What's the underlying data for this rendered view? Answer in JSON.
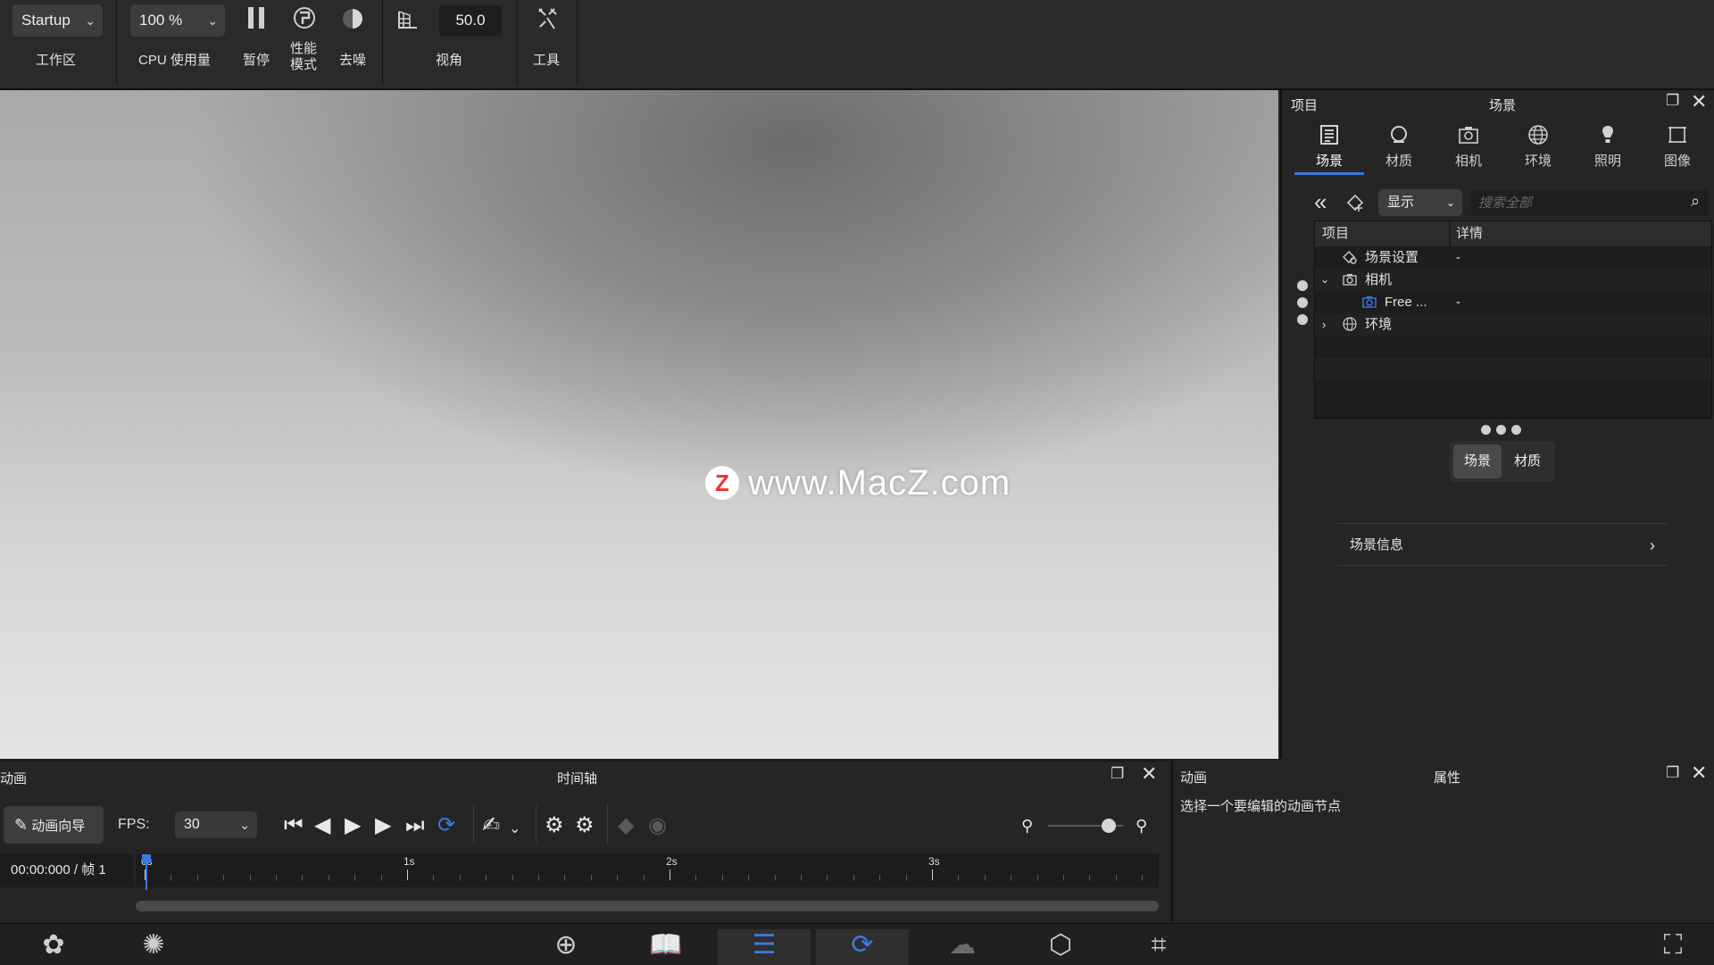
{
  "toolbar": {
    "workspace_value": "Startup",
    "workspace_label": "工作区",
    "cpu_value": "100 %",
    "cpu_label": "CPU 使用量",
    "pause_label": "暂停",
    "perf_label_1": "性能",
    "perf_label_2": "模式",
    "denoise_label": "去噪",
    "fov_value": "50.0",
    "view_label": "视角",
    "tools_label": "工具"
  },
  "watermark": {
    "text": "www.MacZ.com",
    "logo": "Z"
  },
  "right_panel": {
    "title_left": "项目",
    "title_center": "场景",
    "tabs": [
      {
        "label": "场景",
        "icon": "list-icon"
      },
      {
        "label": "材质",
        "icon": "material-icon"
      },
      {
        "label": "相机",
        "icon": "camera-icon"
      },
      {
        "label": "环境",
        "icon": "globe-icon"
      },
      {
        "label": "照明",
        "icon": "bulb-icon"
      },
      {
        "label": "图像",
        "icon": "image-frame-icon"
      }
    ],
    "filter_value": "显示",
    "search_placeholder": "搜索全部",
    "tree_headers": {
      "item": "项目",
      "detail": "详情"
    },
    "tree_rows": [
      {
        "label": "场景设置",
        "detail": "-"
      },
      {
        "label": "相机",
        "detail": ""
      },
      {
        "label": "Free ...",
        "detail": "-"
      },
      {
        "label": "环境",
        "detail": ""
      }
    ],
    "segment": [
      "场景",
      "材质"
    ],
    "scene_info": "场景信息"
  },
  "animation": {
    "title": "动画",
    "center_title": "时间轴",
    "wizard_label": "动画向导",
    "fps_label": "FPS:",
    "fps_value": "30",
    "time_readout": "00:00:000 / 帧 1",
    "ruler_labels": [
      "0s",
      "1s",
      "2s",
      "3s"
    ]
  },
  "properties": {
    "title": "动画",
    "center_title": "属性",
    "message": "选择一个要编辑的动画节点"
  },
  "colors": {
    "accent": "#3a7ae0",
    "bg": "#232323"
  }
}
